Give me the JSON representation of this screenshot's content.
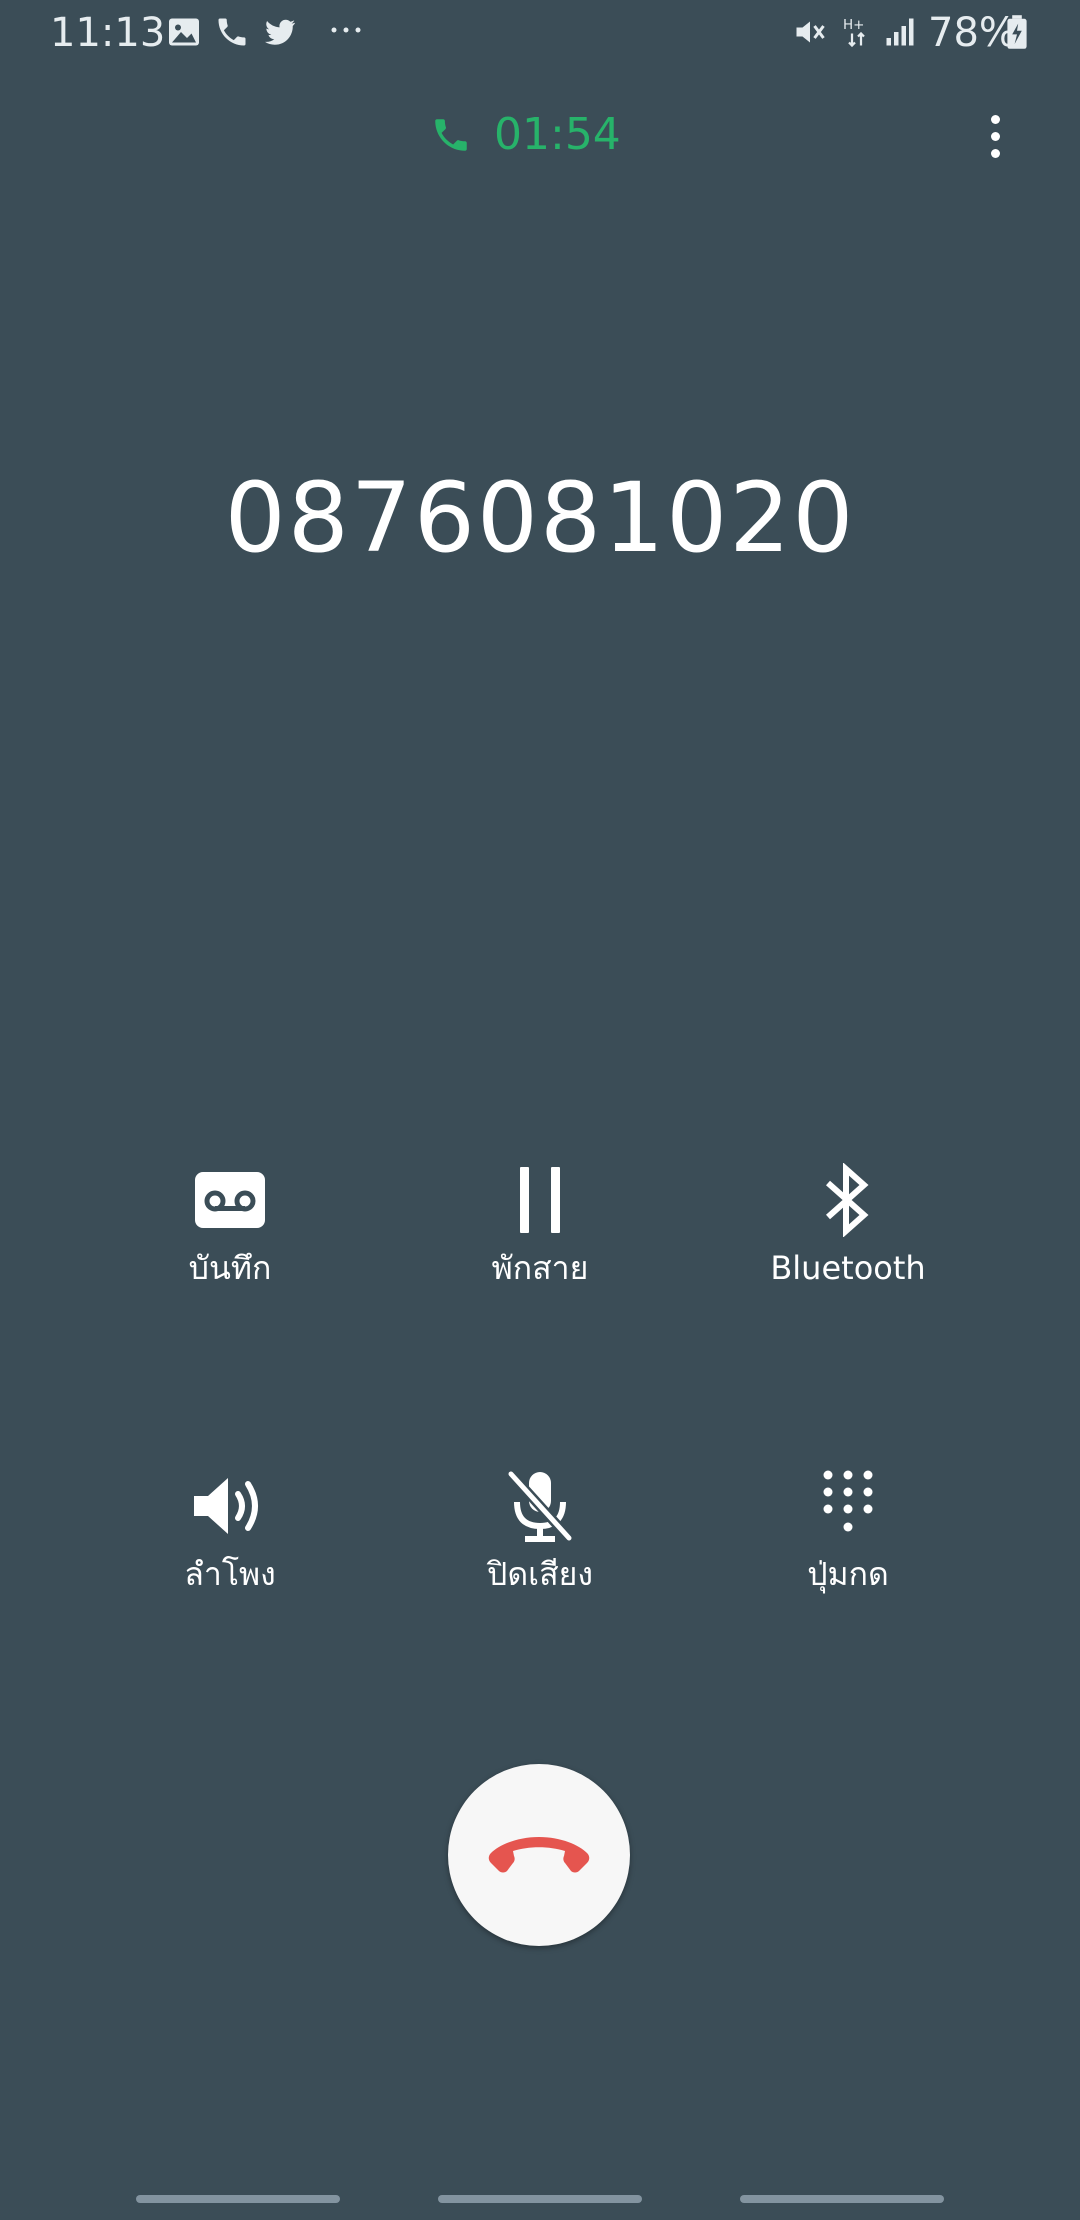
{
  "status_bar": {
    "time": "11:13",
    "left_icons": [
      "gallery-icon",
      "phone-icon",
      "twitter-icon",
      "more-notifications-icon"
    ],
    "right_icons": [
      "mute-icon",
      "hplus-data-icon",
      "signal-icon",
      "battery-charging-icon"
    ],
    "battery": "78%"
  },
  "call": {
    "duration": "01:54",
    "number": "0876081020",
    "accent_color": "#27b36a"
  },
  "actions": {
    "record": {
      "label": "บันทึก",
      "icon": "voicemail-record-icon"
    },
    "hold": {
      "label": "พักสาย",
      "icon": "pause-icon"
    },
    "bluetooth": {
      "label": "Bluetooth",
      "icon": "bluetooth-icon"
    },
    "speaker": {
      "label": "ลำโพง",
      "icon": "speaker-icon"
    },
    "mute": {
      "label": "ปิดเสียง",
      "icon": "mic-off-icon"
    },
    "keypad": {
      "label": "ปุ่มกด",
      "icon": "keypad-icon"
    }
  },
  "end_call": {
    "icon": "end-call-icon",
    "color": "#e5554f"
  },
  "colors": {
    "background": "#3b4d57",
    "end_button_bg": "#f7f7f7"
  }
}
